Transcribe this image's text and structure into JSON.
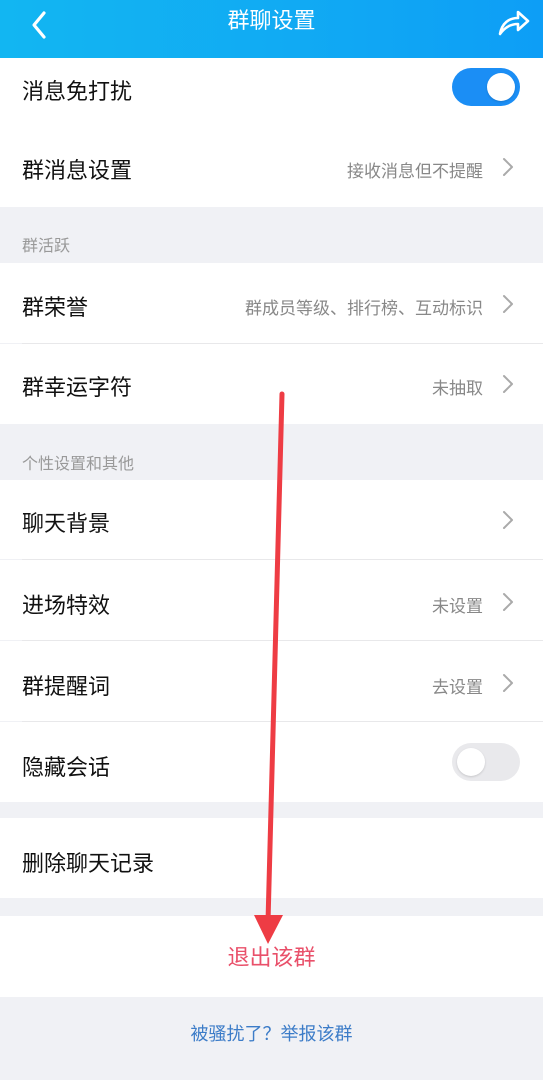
{
  "navbar": {
    "title": "群聊设置",
    "back_icon": "chevron-left-icon",
    "share_icon": "share-arrow-icon"
  },
  "rows": {
    "dnd": {
      "label": "消息免打扰",
      "toggle": "on"
    },
    "msg_settings": {
      "label": "群消息设置",
      "value": "接收消息但不提醒"
    },
    "honor": {
      "label": "群荣誉",
      "value": "群成员等级、排行榜、互动标识"
    },
    "lucky": {
      "label": "群幸运字符",
      "value": "未抽取"
    },
    "chat_bg": {
      "label": "聊天背景",
      "value": ""
    },
    "entry_effect": {
      "label": "进场特效",
      "value": "未设置"
    },
    "reminder": {
      "label": "群提醒词",
      "value": "去设置"
    },
    "hide_chat": {
      "label": "隐藏会话",
      "toggle": "off"
    },
    "delete_history": {
      "label": "删除聊天记录"
    }
  },
  "sections": {
    "activity": "群活跃",
    "personal": "个性设置和其他"
  },
  "exit": {
    "label": "退出该群"
  },
  "report": {
    "label": "被骚扰了？举报该群"
  },
  "colors": {
    "navbar": "#11aaf3",
    "toggle_on": "#1b8ef5",
    "exit_text": "#e9506a",
    "link_text": "#3c7cc8",
    "annotation_arrow": "#ee3c44"
  }
}
